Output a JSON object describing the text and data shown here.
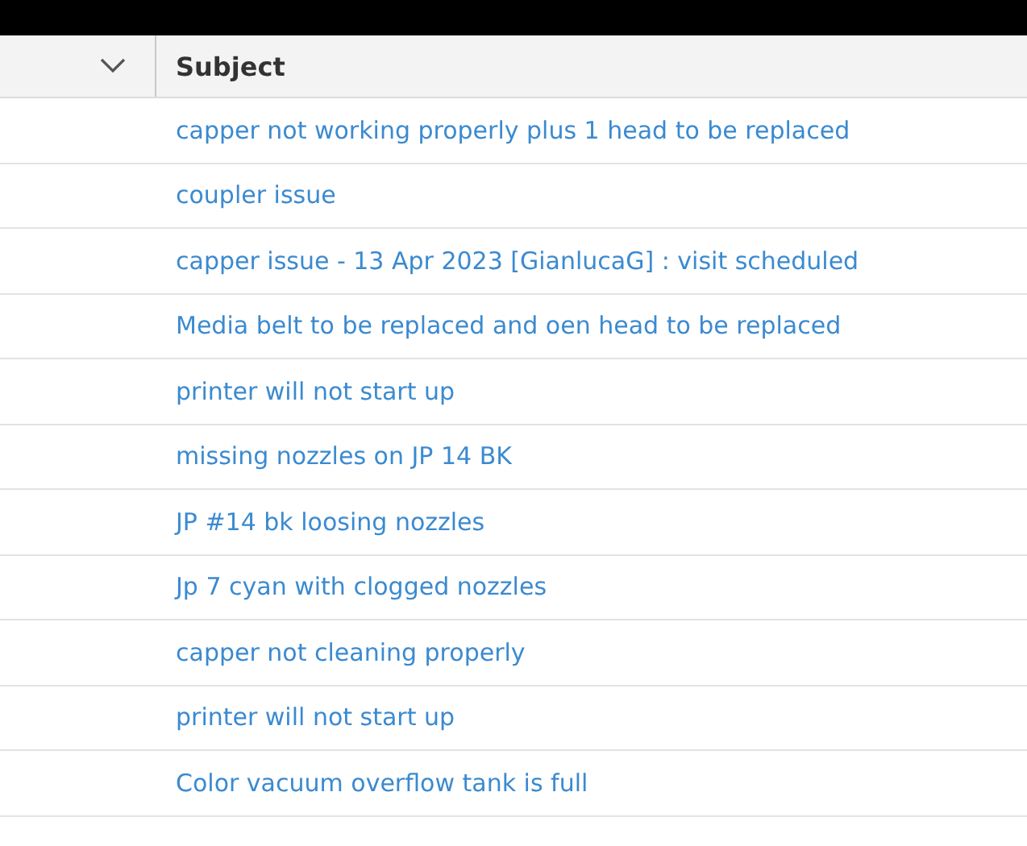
{
  "table": {
    "columns": [
      {
        "label": "Subject"
      }
    ],
    "rows": [
      {
        "subject": "capper not working properly plus 1 head to be replaced"
      },
      {
        "subject": "coupler issue"
      },
      {
        "subject": "capper issue - 13 Apr 2023 [GianlucaG] : visit scheduled"
      },
      {
        "subject": "Media belt to be replaced and oen head to be replaced"
      },
      {
        "subject": "printer will not start up"
      },
      {
        "subject": "missing nozzles on JP 14 BK"
      },
      {
        "subject": "JP #14 bk loosing nozzles"
      },
      {
        "subject": "Jp 7 cyan with clogged nozzles"
      },
      {
        "subject": "capper not cleaning properly"
      },
      {
        "subject": "printer will not start up"
      },
      {
        "subject": "Color vacuum overflow tank is full"
      }
    ]
  }
}
